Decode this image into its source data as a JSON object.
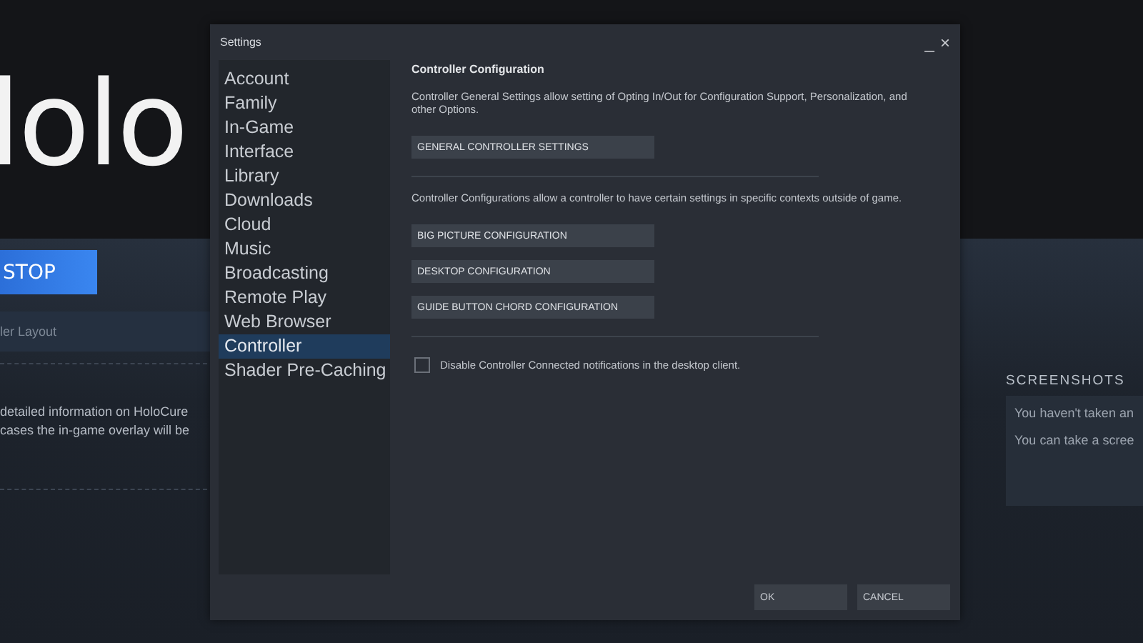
{
  "background": {
    "title": "lolo",
    "play_button": "STOP",
    "tab_label": "ler Layout",
    "info_lines": [
      "detailed information on HoloCure",
      "cases the in-game overlay will be"
    ],
    "screenshots": {
      "heading": "SCREENSHOTS",
      "lines": [
        "You haven't taken an",
        "You can take a scree"
      ]
    }
  },
  "dialog": {
    "title": "Settings",
    "window_controls": [
      "_",
      "×"
    ],
    "sidebar": {
      "items": [
        {
          "label": "Account",
          "selected": false
        },
        {
          "label": "Family",
          "selected": false
        },
        {
          "label": "In-Game",
          "selected": false
        },
        {
          "label": "Interface",
          "selected": false
        },
        {
          "label": "Library",
          "selected": false
        },
        {
          "label": "Downloads",
          "selected": false
        },
        {
          "label": "Cloud",
          "selected": false
        },
        {
          "label": "Music",
          "selected": false
        },
        {
          "label": "Broadcasting",
          "selected": false
        },
        {
          "label": "Remote Play",
          "selected": false
        },
        {
          "label": "Web Browser",
          "selected": false
        },
        {
          "label": "Controller",
          "selected": true
        },
        {
          "label": "Shader Pre-Caching",
          "selected": false
        }
      ]
    },
    "content": {
      "heading": "Controller Configuration",
      "sections": [
        {
          "description": "Controller General Settings allow setting of Opting In/Out for Configuration Support, Personalization, and other Options.",
          "buttons": [
            "GENERAL CONTROLLER SETTINGS"
          ]
        },
        {
          "description": "Controller Configurations allow a controller to have certain settings in specific contexts outside of game.",
          "buttons": [
            "BIG PICTURE CONFIGURATION",
            "DESKTOP CONFIGURATION",
            "GUIDE BUTTON CHORD CONFIGURATION"
          ]
        }
      ],
      "checkbox": {
        "label": "Disable Controller Connected notifications in the desktop client.",
        "checked": false
      }
    },
    "buttons": [
      "OK",
      "CANCEL"
    ]
  }
}
